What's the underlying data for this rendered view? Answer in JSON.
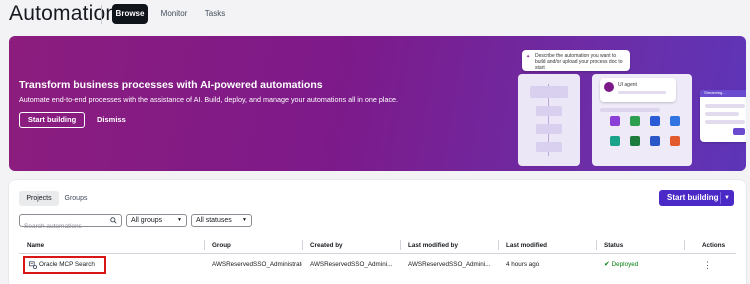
{
  "header": {
    "title": "Automations",
    "tabs": [
      {
        "label": "Browse",
        "active": true
      },
      {
        "label": "Monitor",
        "active": false
      },
      {
        "label": "Tasks",
        "active": false
      }
    ]
  },
  "banner": {
    "heading": "Transform business processes with AI-powered automations",
    "subtext": "Automate end-to-end processes with the assistance of AI. Build, deploy, and manage your automations all in one place.",
    "primary_label": "Start building",
    "dismiss_label": "Dismiss",
    "illustration": {
      "prompt_text": "Describe the automation you want to build and/or upload your process doc to start",
      "agent_label": "UI agent",
      "streaming_label": "Streaming..."
    }
  },
  "projects": {
    "tabs": [
      {
        "label": "Projects",
        "active": true
      },
      {
        "label": "Groups",
        "active": false
      }
    ],
    "start_building_label": "Start building",
    "search": {
      "placeholder": "Search automations",
      "value": ""
    },
    "filters": {
      "groups": "All groups",
      "statuses": "All statuses"
    },
    "columns": [
      "Name",
      "Group",
      "Created by",
      "Last modified by",
      "Last modified",
      "Status",
      "Actions"
    ],
    "rows": [
      {
        "name": "Oracle MCP Search",
        "group": "AWSReservedSSO_Administrato",
        "created_by": "AWSReservedSSO_Admini...",
        "last_modified_by": "AWSReservedSSO_Admini...",
        "last_modified": "4 hours ago",
        "status": "Deployed"
      }
    ]
  },
  "colors": {
    "accent": "#4b29c6",
    "banner_start": "#8c1d7e",
    "banner_end": "#5d35b8",
    "status_ok": "#037f0c",
    "highlight": "#d91515"
  }
}
